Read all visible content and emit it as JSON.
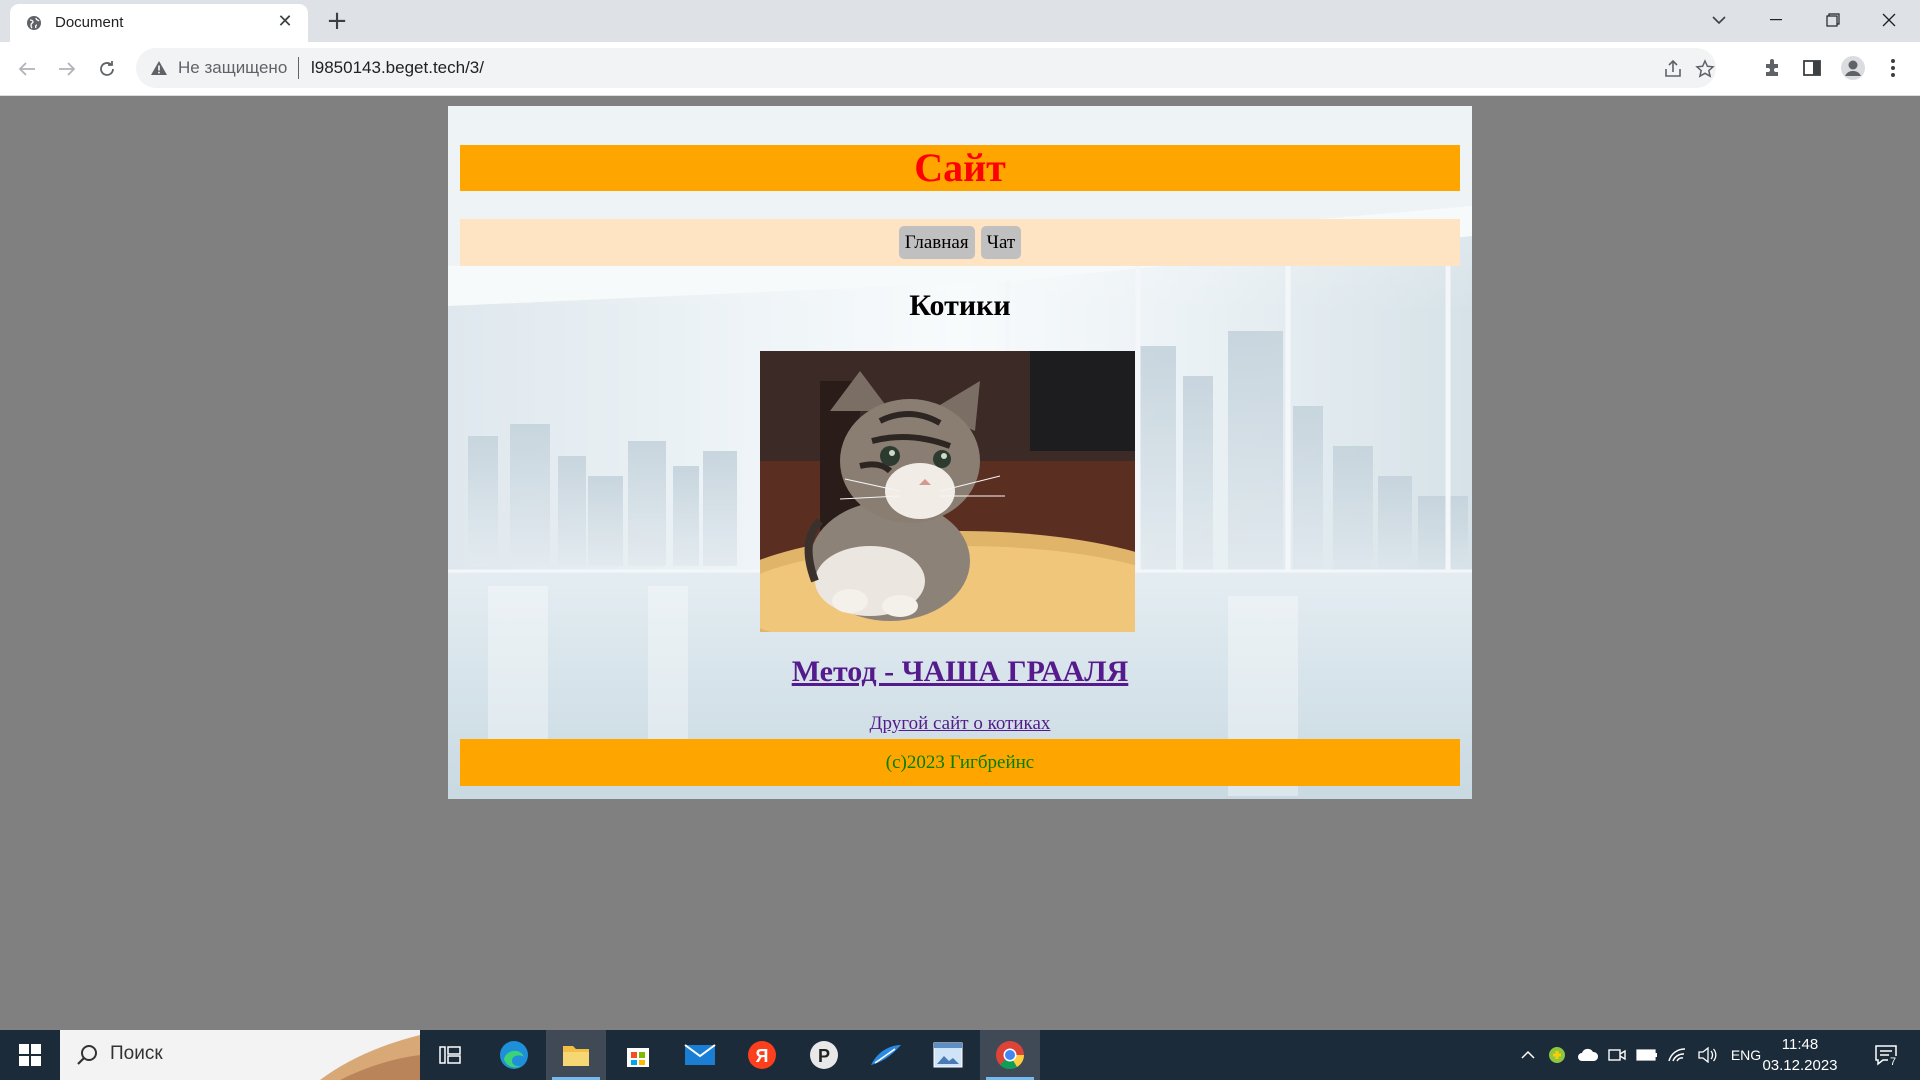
{
  "browser": {
    "tab_title": "Document",
    "not_secure_label": "Не защищено",
    "url": "l9850143.beget.tech/3/"
  },
  "site": {
    "header_title": "Сайт",
    "nav": [
      "Главная",
      "Чат"
    ],
    "heading": "Котики",
    "image_icon": "kitten-photo",
    "link_primary": "Метод - ЧАША ГРААЛЯ",
    "link_secondary": "Другой сайт о котиках",
    "footer": "(c)2023 Гигбрейнс",
    "colors": {
      "header_bg": "#ffa500",
      "header_text": "#ff0000",
      "nav_bg": "#ffe4c4",
      "nav_button_bg": "#c0c0c0",
      "link": "#551a8b",
      "footer_text": "#008000",
      "body_bg": "#808080"
    }
  },
  "taskbar": {
    "search_label": "Поиск",
    "language": "ENG",
    "time": "11:48",
    "date": "03.12.2023",
    "notifications": "7"
  }
}
